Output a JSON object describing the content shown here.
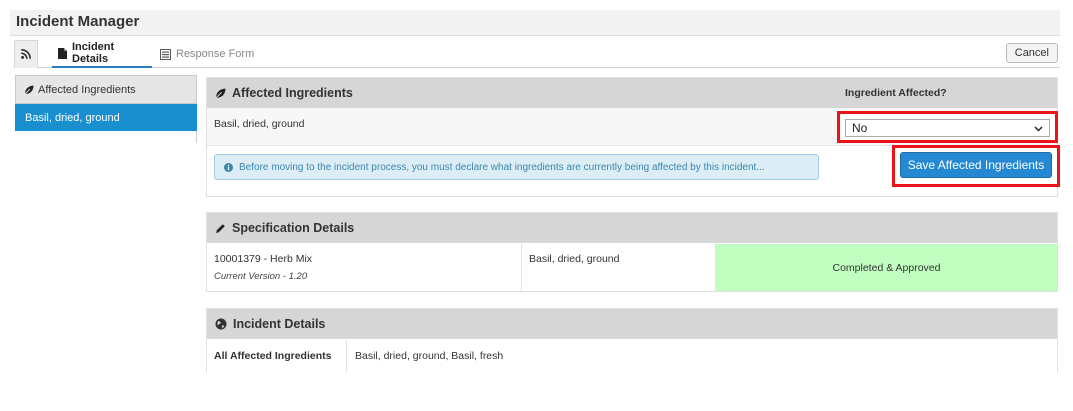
{
  "app": {
    "title": "Incident Manager"
  },
  "tabs": [
    {
      "icon": "rss-icon",
      "label": ""
    },
    {
      "icon": "document-icon",
      "label": "Incident Details"
    },
    {
      "icon": "form-icon",
      "label": "Response Form"
    }
  ],
  "toolbar": {
    "cancel_label": "Cancel"
  },
  "sidebar": {
    "header": {
      "icon": "leaf-icon",
      "label": "Affected Ingredients"
    },
    "items": [
      {
        "label": "Basil, dried, ground",
        "active": true
      }
    ]
  },
  "affected_panel": {
    "icon": "leaf-icon",
    "title": "Affected Ingredients",
    "column_header": "Ingredient Affected?",
    "row": {
      "ingredient": "Basil, dried, ground",
      "affected_value": "No"
    },
    "info_text": "Before moving to the incident process, you must declare what ingredients are currently being affected by this incident...",
    "save_label": "Save Affected Ingredients"
  },
  "spec_panel": {
    "icon": "pencil-icon",
    "title": "Specification Details",
    "row": {
      "spec": "10001379 - Herb Mix",
      "version_label": "Current Version",
      "version_value": " - 1.20",
      "ingredient": "Basil, dried, ground",
      "status": "Completed & Approved"
    }
  },
  "incident_panel": {
    "icon": "globe-icon",
    "title": "Incident Details",
    "row": {
      "label": "All Affected Ingredients",
      "value": "Basil, dried, ground, Basil, fresh"
    }
  },
  "colors": {
    "active_blue": "#1a8fd0",
    "button_blue": "#2488d2",
    "highlight_red": "#e8141b",
    "approved_green": "#c0ffc0",
    "info_bg": "#dcedf6"
  }
}
